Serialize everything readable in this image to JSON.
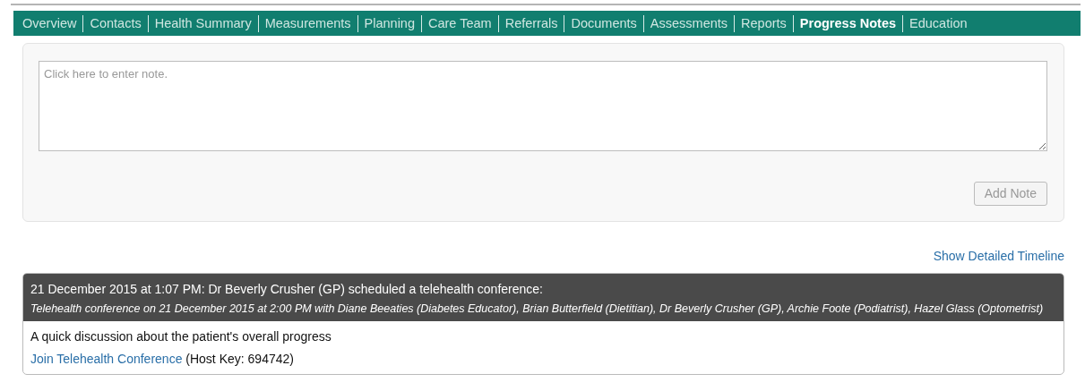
{
  "tabs": [
    {
      "label": "Overview",
      "selected": false
    },
    {
      "label": "Contacts",
      "selected": false
    },
    {
      "label": "Health Summary",
      "selected": false
    },
    {
      "label": "Measurements",
      "selected": false
    },
    {
      "label": "Planning",
      "selected": false
    },
    {
      "label": "Care Team",
      "selected": false
    },
    {
      "label": "Referrals",
      "selected": false
    },
    {
      "label": "Documents",
      "selected": false
    },
    {
      "label": "Assessments",
      "selected": false
    },
    {
      "label": "Reports",
      "selected": false
    },
    {
      "label": "Progress Notes",
      "selected": true
    },
    {
      "label": "Education",
      "selected": false
    }
  ],
  "note_form": {
    "placeholder": "Click here to enter note.",
    "add_button": {
      "label": "Add Note",
      "disabled": true
    }
  },
  "timeline_link": "Show Detailed Timeline",
  "notes": [
    {
      "heading": "21 December 2015 at 1:07 PM: Dr Beverly Crusher (GP) scheduled a telehealth conference:",
      "subheading": "Telehealth conference on 21 December 2015 at 2:00 PM with Diane Beeaties (Diabetes Educator), Brian Butterfield (Dietitian), Dr Beverly Crusher (GP), Archie Foote (Podiatrist), Hazel Glass (Optometrist)",
      "body": "A quick discussion about the patient's overall progress",
      "link": "Join Telehealth Conference",
      "link_note": "(Host Key: 694742)"
    }
  ]
}
